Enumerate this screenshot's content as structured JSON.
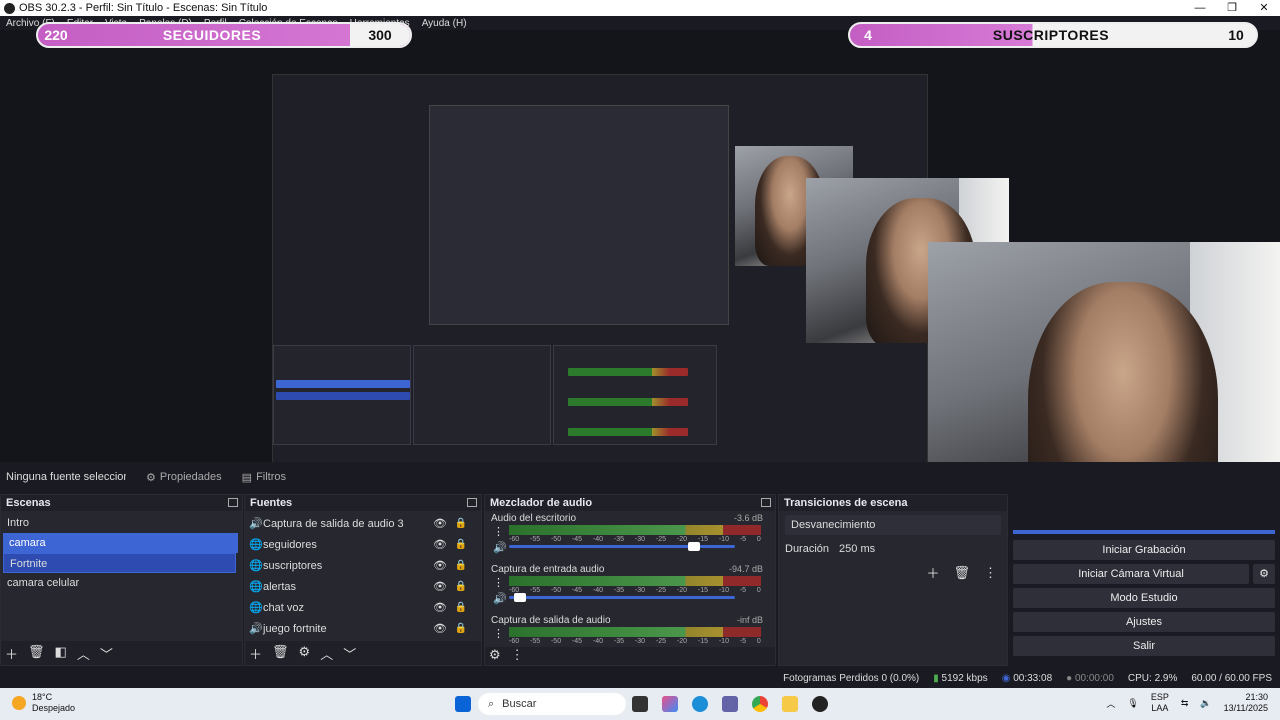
{
  "window": {
    "title": "OBS 30.2.3 - Perfil: Sin Título - Escenas: Sin Título",
    "min": "—",
    "max": "❐",
    "close": "✕"
  },
  "menu": [
    "Archivo (F)",
    "Editar",
    "Vista",
    "Paneles (D)",
    "Perfil",
    "Colección de Escenas",
    "Herramientas",
    "Ayuda (H)"
  ],
  "overlays": {
    "left": {
      "count": "220",
      "label": "SEGUIDORES",
      "goal": "300"
    },
    "right": {
      "count": "4",
      "label": "SUSCRIPTORES",
      "goal": "10"
    }
  },
  "source_bar": {
    "no_source": "Ninguna fuente seleccionada",
    "properties": "Propiedades",
    "filters": "Filtros"
  },
  "scenes": {
    "title": "Escenas",
    "items": [
      "Intro",
      "camara",
      "Fortnite",
      "camara celular"
    ],
    "selected": "camara"
  },
  "sources": {
    "title": "Fuentes",
    "items": [
      {
        "name": "Captura de salida de audio 3",
        "icon": "speaker"
      },
      {
        "name": "seguidores",
        "icon": "globe"
      },
      {
        "name": "suscriptores",
        "icon": "globe"
      },
      {
        "name": "alertas",
        "icon": "globe"
      },
      {
        "name": "chat voz",
        "icon": "globe"
      },
      {
        "name": "juego fortnite",
        "icon": "speaker"
      }
    ]
  },
  "mixer": {
    "title": "Mezclador de audio",
    "ticks": [
      "-60",
      "-55",
      "-50",
      "-45",
      "-40",
      "-35",
      "-30",
      "-25",
      "-20",
      "-15",
      "-10",
      "-5",
      "0"
    ],
    "channels": [
      {
        "name": "Audio del escritorio",
        "db": "-3.6 dB",
        "level": 0.82
      },
      {
        "name": "Captura de entrada audio",
        "db": "-94.7 dB",
        "level": 0.05
      },
      {
        "name": "Captura de salida de audio",
        "db": "-inf dB",
        "level": 0.0
      }
    ]
  },
  "transitions": {
    "title": "Transiciones de escena",
    "selected": "Desvanecimiento",
    "duration_label": "Duración",
    "duration_value": "250 ms"
  },
  "controls": [
    "Iniciar Grabación",
    "Iniciar Cámara Virtual",
    "Modo Estudio",
    "Ajustes",
    "Salir"
  ],
  "status": {
    "dropped": "Fotogramas Perdidos 0 (0.0%)",
    "bitrate": "5192 kbps",
    "stream_time": "00:33:08",
    "rec_time": "00:00:00",
    "cpu": "CPU: 2.9%",
    "fps": "60.00 / 60.00 FPS"
  },
  "taskbar": {
    "temp": "18°C",
    "weather": "Despejado",
    "search": "Buscar",
    "lang": "ESP",
    "lang2": "LAA",
    "time": "21:30",
    "date": "13/11/2025"
  }
}
